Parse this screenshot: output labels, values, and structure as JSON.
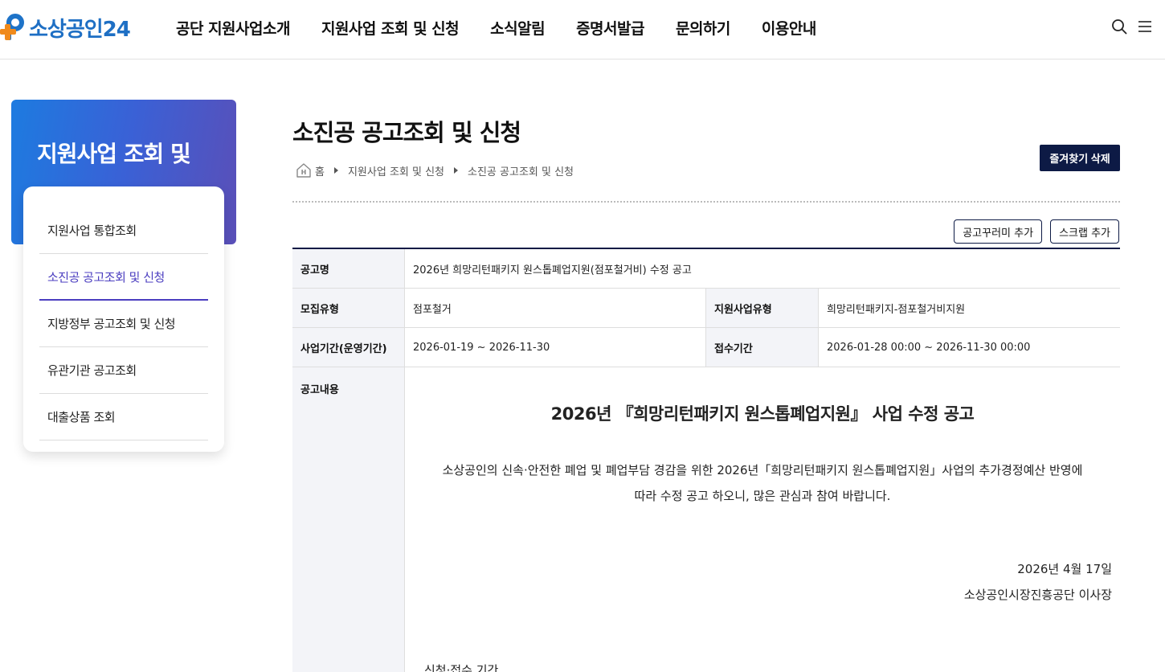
{
  "header": {
    "logo_text": "소상공인24",
    "nav": [
      "공단 지원사업소개",
      "지원사업 조회 및 신청",
      "소식알림",
      "증명서발급",
      "문의하기",
      "이용안내"
    ],
    "icons": [
      "search-icon",
      "menu-icon"
    ]
  },
  "sidebar": {
    "banner_title": "지원사업 조회 및",
    "items": [
      {
        "label": "지원사업 통합조회",
        "active": false
      },
      {
        "label": "소진공 공고조회 및 신청",
        "active": true
      },
      {
        "label": "지방정부 공고조회 및 신청",
        "active": false
      },
      {
        "label": "유관기관 공고조회",
        "active": false
      },
      {
        "label": "대출상품 조회",
        "active": false
      }
    ]
  },
  "page": {
    "title": "소진공 공고조회 및 신청",
    "fav_delete_label": "즐겨찾기 삭제",
    "breadcrumb": [
      "홈",
      "지원사업 조회 및 신청",
      "소진공 공고조회 및 신청"
    ],
    "actions": [
      "공고꾸러미 추가",
      "스크랩 추가"
    ]
  },
  "notice": {
    "name_label": "공고명",
    "name_value": "2026년 희망리턴패키지 원스톱폐업지원(점포철거비) 수정 공고",
    "recruit_type_label": "모집유형",
    "recruit_type_value": "점포철거",
    "support_type_label": "지원사업유형",
    "support_type_value": "희망리턴패키지-점포철거비지원",
    "period_label": "사업기간(운영기간)",
    "period_value": "2026-01-19 ~ 2026-11-30",
    "reception_label": "접수기간",
    "reception_value": "2026-01-28 00:00 ~ 2026-11-30 00:00",
    "content_label": "공고내용",
    "content_title": "2026년 『희망리턴패키지 원스톱폐업지원』 사업 수정 공고",
    "content_para_1": "소상공인의 신속·안전한 폐업 및 폐업부담 경감을 위한 2026년「희망리턴패키지 원스톱폐업지원」사업의 추가경정예산 반영에",
    "content_para_2": "따라 수정 공고 하오니, 많은 관심과 참여 바랍니다.",
    "content_date": "2026년 4월 17일",
    "content_signer": "소상공인시장진흥공단 이사장",
    "content_cut": "신청·접수 기간"
  },
  "colors": {
    "brand_blue": "#1e6fc4",
    "brand_orange": "#f08a1c",
    "navy": "#0d1a45",
    "active_purple": "#4b3ec0"
  }
}
